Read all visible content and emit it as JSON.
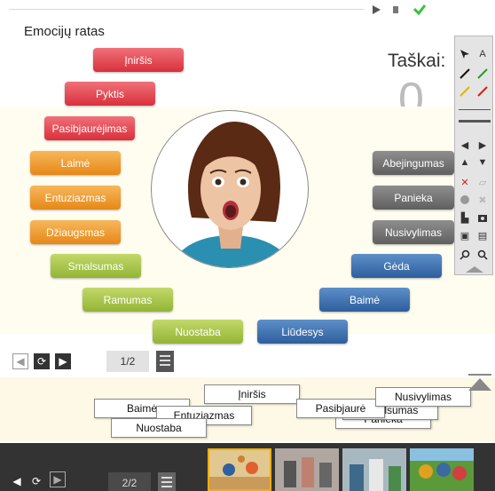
{
  "title": "Emocijų ratas",
  "score": {
    "label": "Taškai:",
    "value": "0"
  },
  "emotions": {
    "inirsis": "Įniršis",
    "pyktis": "Pyktis",
    "pasibjaurejimas": "Pasibjaurėjimas",
    "laime": "Laimė",
    "entuziazmas": "Entuziazmas",
    "dziaugsmas": "Džiaugsmas",
    "smalsumas": "Smalsumas",
    "ramumas": "Ramumas",
    "nuostaba": "Nuostaba",
    "liudesys": "Liūdesys",
    "baime": "Baimė",
    "geda": "Gėda",
    "nusivylimas": "Nusivylimas",
    "panieka": "Panieka",
    "abejingumas": "Abejingumas"
  },
  "pager": {
    "main": "1/2",
    "bottom": "2/2"
  },
  "toolbar": {
    "text_tool": "A"
  },
  "cards": {
    "inirsis": "Įniršis",
    "baime": "Baimė",
    "entuziazmas": "Entuziazmas",
    "nuostaba": "Nuostaba",
    "pasibjaure": "Pasibjaurė",
    "smalsumas": "Smalsumas",
    "panieka": "Panieka",
    "nusivylimas": "Nusivylimas"
  },
  "colors": {
    "red": "#e0434d",
    "orange": "#ee9a2e",
    "green": "#a6c445",
    "gray": "#727272",
    "blue": "#3d6fae"
  }
}
